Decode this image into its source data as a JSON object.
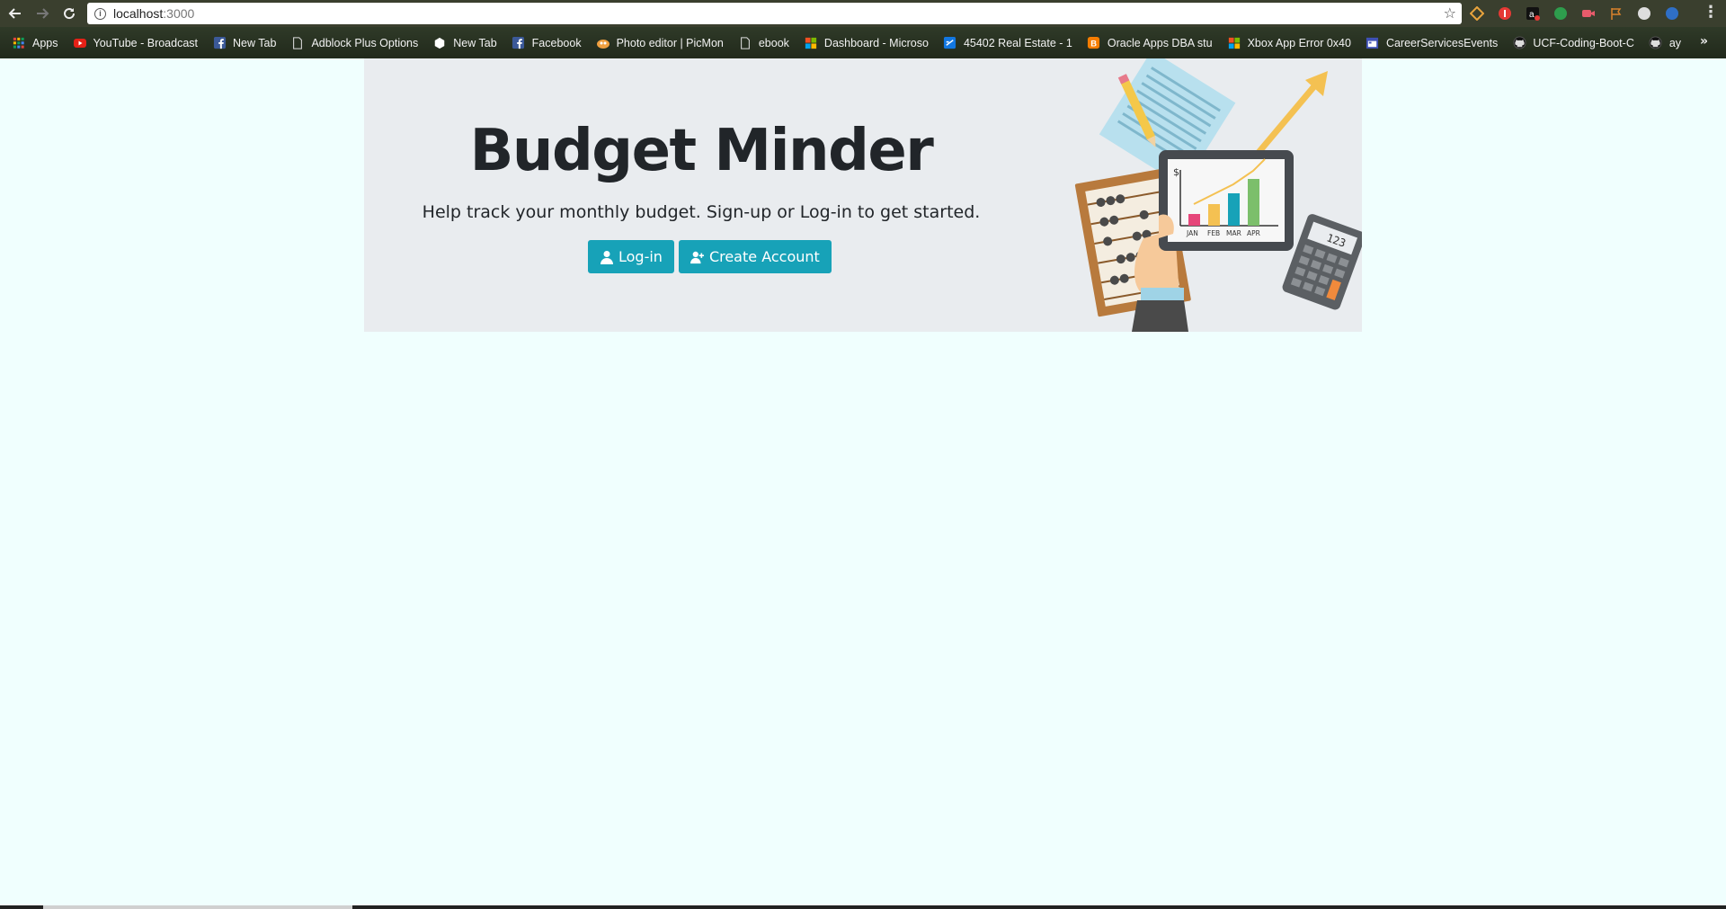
{
  "browser": {
    "url_host": "localhost",
    "url_port": ":3000",
    "bookmarks": [
      {
        "label": "Apps",
        "icon": "apps-grid-icon",
        "color": "#e0443e"
      },
      {
        "label": "YouTube - Broadcast",
        "icon": "youtube-icon",
        "color": "#e62117"
      },
      {
        "label": "New Tab",
        "icon": "facebook-icon",
        "color": "#3b5998"
      },
      {
        "label": "Adblock Plus Options",
        "icon": "page-icon",
        "color": "#dddddd"
      },
      {
        "label": "New Tab",
        "icon": "hexagon-icon",
        "color": "#ffffff"
      },
      {
        "label": "Facebook",
        "icon": "facebook-icon",
        "color": "#3b5998"
      },
      {
        "label": "Photo editor | PicMon",
        "icon": "picmonkey-icon",
        "color": "#f0a040"
      },
      {
        "label": "ebook",
        "icon": "page-icon",
        "color": "#dddddd"
      },
      {
        "label": "Dashboard - Microso",
        "icon": "microsoft-icon",
        "color": "#f25022"
      },
      {
        "label": "45402 Real Estate - 1",
        "icon": "zillow-icon",
        "color": "#1277e1"
      },
      {
        "label": "Oracle Apps DBA stu",
        "icon": "blogger-icon",
        "color": "#f57d00"
      },
      {
        "label": "Xbox App Error 0x40",
        "icon": "microsoft-icon",
        "color": "#f25022"
      },
      {
        "label": "CareerServicesEvents",
        "icon": "calendar-icon",
        "color": "#3f51b5"
      },
      {
        "label": "UCF-Coding-Boot-C",
        "icon": "github-icon",
        "color": "#222222"
      },
      {
        "label": "ay",
        "icon": "github-icon",
        "color": "#222222"
      }
    ],
    "more_label": "»"
  },
  "hero": {
    "title": "Budget Minder",
    "lead": "Help track your monthly budget. Sign-up or Log-in to get started.",
    "login_label": "Log-in",
    "create_label": "Create Account",
    "accent": "#17a2b8"
  },
  "illustration": {
    "chart_labels": [
      "JAN",
      "FEB",
      "MAR",
      "APR"
    ],
    "currency_symbol": "$",
    "calculator_display": "123"
  }
}
